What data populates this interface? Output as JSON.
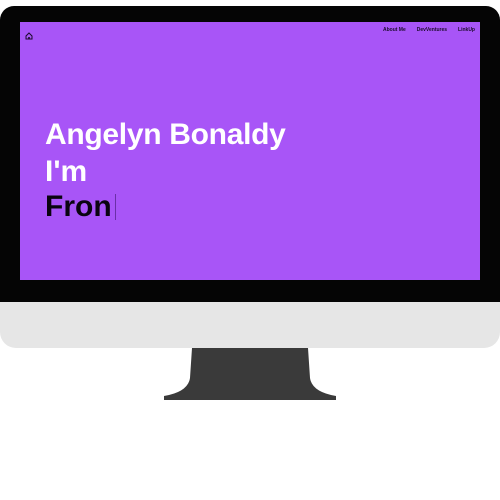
{
  "colors": {
    "screen_bg": "#a855f7",
    "bezel": "#050505",
    "chin": "#e6e6e6",
    "stand": "#3a3a3a"
  },
  "nav": {
    "home_icon": "home-icon",
    "links": [
      "About Me",
      "DevVentures",
      "LinkUp"
    ]
  },
  "hero": {
    "name": "Angelyn Bonaldy",
    "intro": "I'm",
    "role_typed": "Fron"
  }
}
